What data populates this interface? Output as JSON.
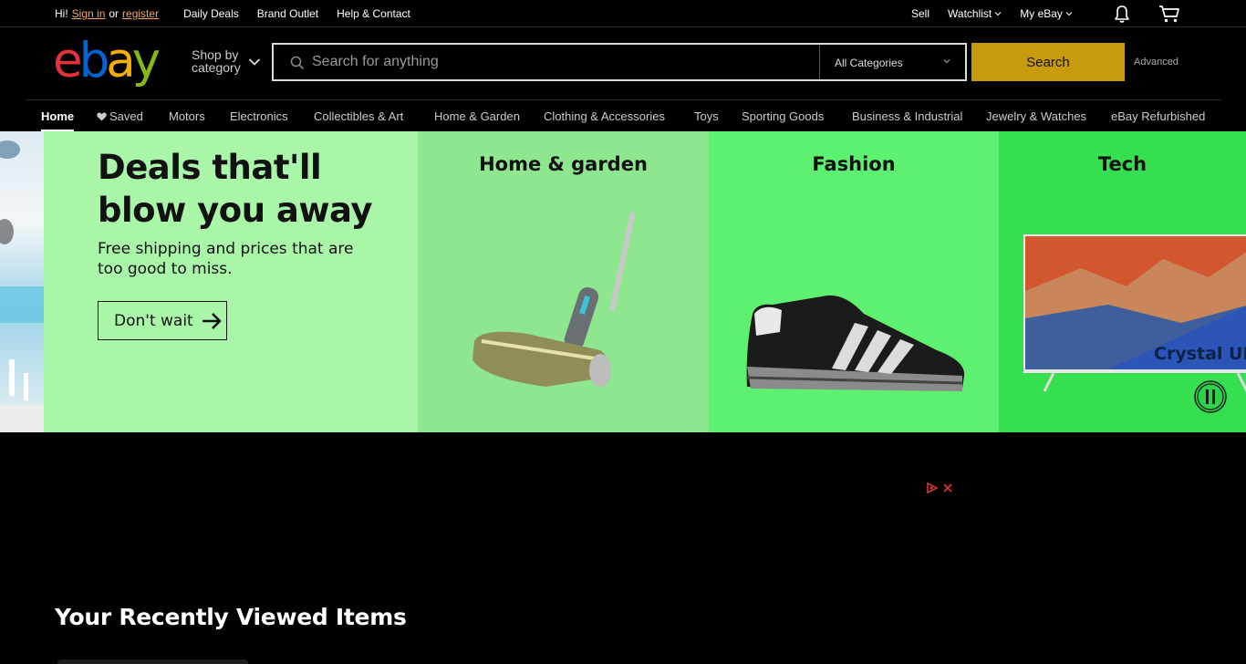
{
  "topbar": {
    "greeting": "Hi!",
    "sign_in": "Sign in",
    "or": "or",
    "register": "register",
    "links": [
      "Daily Deals",
      "Brand Outlet",
      "Help & Contact"
    ],
    "sell": "Sell",
    "watchlist": "Watchlist",
    "my_ebay": "My eBay",
    "icons": [
      "bell-icon",
      "cart-icon"
    ]
  },
  "header": {
    "logo": {
      "e": "e",
      "b": "b",
      "a": "a",
      "y": "y"
    },
    "logo_colors": {
      "e": "#e53238",
      "b": "#0064d2",
      "a": "#f5af02",
      "y": "#86b817"
    },
    "shop_by_line1": "Shop by",
    "shop_by_line2": "category",
    "search_placeholder": "Search for anything",
    "category_selected": "All Categories",
    "search_button": "Search",
    "search_button_color": "#c89a0e",
    "advanced": "Advanced"
  },
  "nav": {
    "saved": "Saved",
    "items": [
      "Home",
      "Saved",
      "Motors",
      "Electronics",
      "Collectibles & Art",
      "Home & Garden",
      "Clothing & Accessories",
      "Toys",
      "Sporting Goods",
      "Business & Industrial",
      "Jewelry & Watches",
      "eBay Refurbished"
    ]
  },
  "hero": {
    "headline": "Deals that'll blow you away",
    "subtext": "Free shipping and prices that are too good to miss.",
    "cta": "Don't wait",
    "panels": [
      {
        "title": "Home & garden",
        "color": "#8ee78e"
      },
      {
        "title": "Fashion",
        "color": "#5ef070"
      },
      {
        "title": "Tech",
        "color": "#36df4f"
      }
    ],
    "main_color": "#aaf6a9",
    "tv_text": "Crystal UH"
  },
  "recently_viewed": {
    "title": "Your Recently Viewed Items"
  }
}
